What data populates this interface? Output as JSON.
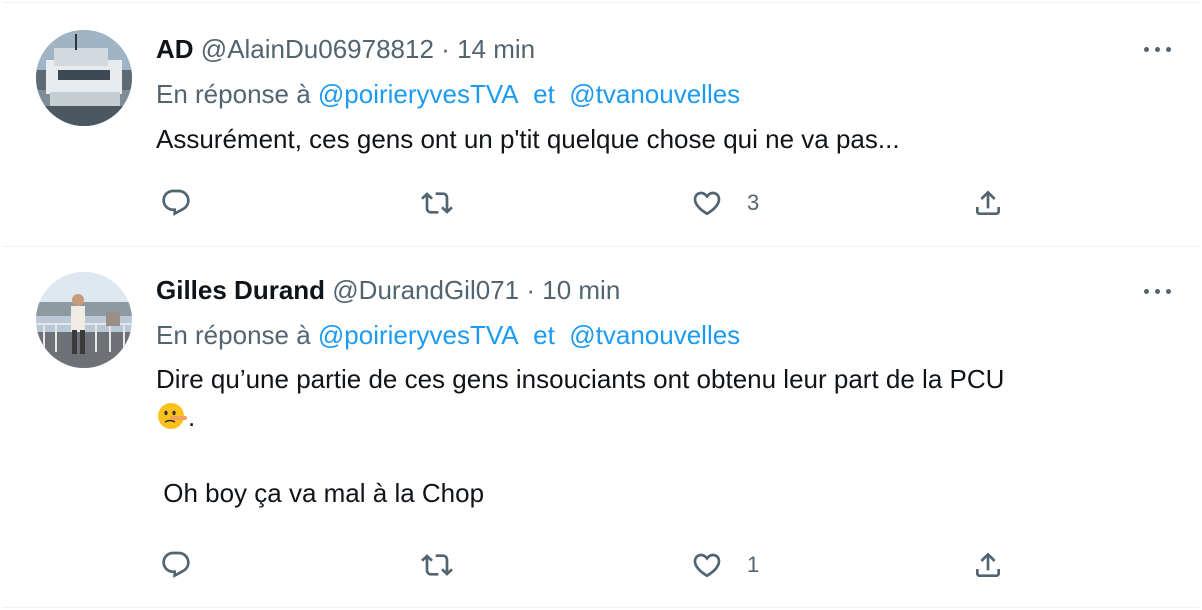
{
  "tweets": [
    {
      "name": "AD",
      "handle": "@AlainDu06978812",
      "separator": "·",
      "time": "14 min",
      "reply_prefix": "En réponse à",
      "reply_to_1": "@poirieryvesTVA",
      "reply_join": "et",
      "reply_to_2": "@tvanouvelles",
      "text_lines": [
        "Assurément, ces gens ont un p'tit quelque chose qui ne va pas..."
      ],
      "like_count": "3",
      "avatar_icon": "boat-photo"
    },
    {
      "name": "Gilles Durand",
      "handle": "@DurandGil071",
      "separator": "·",
      "time": "10 min",
      "reply_prefix": "En réponse à",
      "reply_to_1": "@poirieryvesTVA",
      "reply_join": "et",
      "reply_to_2": "@tvanouvelles",
      "text_line_1": "Dire qu’une partie de ces gens insouciants ont obtenu leur part de la PCU",
      "text_line_2_suffix": ".",
      "text_line_3": " Oh boy ça va mal à la Chop",
      "emoji": "lying-face-emoji",
      "like_count": "1",
      "avatar_icon": "man-on-bridge-photo"
    }
  ],
  "icons": {
    "reply": "reply-icon",
    "retweet": "retweet-icon",
    "like": "heart-icon",
    "share": "share-icon",
    "more": "more-icon"
  },
  "colors": {
    "text": "#0f1419",
    "secondary": "#536471",
    "link": "#1d9bf0",
    "divider": "#eff3f4"
  }
}
